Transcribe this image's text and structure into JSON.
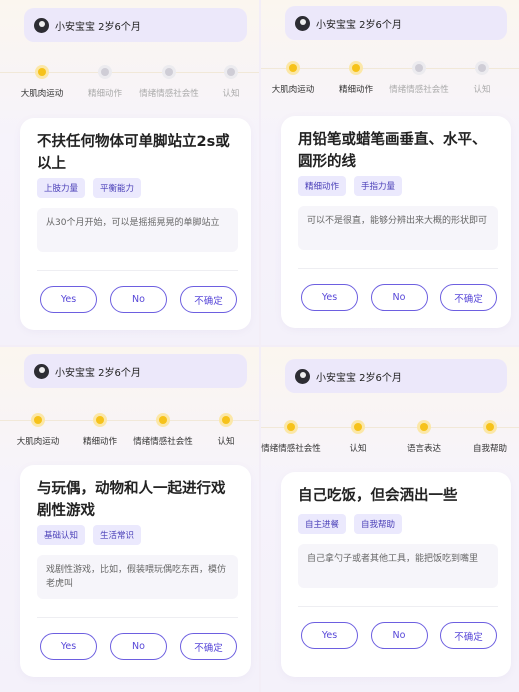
{
  "profile": {
    "name": "小安宝宝 2岁6个月",
    "avatar_icon": "baby-avatar"
  },
  "colors": {
    "accent": "#5747d8",
    "step_active": "#f6c21a",
    "tag_bg": "#ebe9fd"
  },
  "buttons": {
    "yes": "Yes",
    "no": "No",
    "unsure": "不确定"
  },
  "panels": [
    {
      "steps": [
        {
          "label": "大肌肉运动",
          "active": true
        },
        {
          "label": "精细动作",
          "active": false
        },
        {
          "label": "情绪情感社会性",
          "active": false
        },
        {
          "label": "认知",
          "active": false
        }
      ],
      "question": "不扶任何物体可单脚站立2s或以上",
      "tags": [
        "上肢力量",
        "平衡能力"
      ],
      "description": "从30个月开始，可以是摇摇晃晃的单脚站立"
    },
    {
      "steps": [
        {
          "label": "大肌肉运动",
          "active": true
        },
        {
          "label": "精细动作",
          "active": true
        },
        {
          "label": "情绪情感社会性",
          "active": false
        },
        {
          "label": "认知",
          "active": false
        }
      ],
      "question": "用铅笔或蜡笔画垂直、水平、圆形的线",
      "tags": [
        "精细动作",
        "手指力量"
      ],
      "description": "可以不是很直，能够分辨出来大概的形状即可"
    },
    {
      "steps": [
        {
          "label": "大肌肉运动",
          "active": true
        },
        {
          "label": "精细动作",
          "active": true
        },
        {
          "label": "情绪情感社会性",
          "active": true
        },
        {
          "label": "认知",
          "active": true
        }
      ],
      "question": "与玩偶，动物和人一起进行戏剧性游戏",
      "tags": [
        "基础认知",
        "生活常识"
      ],
      "description": "戏剧性游戏，比如，假装喂玩偶吃东西，模仿老虎叫"
    },
    {
      "steps": [
        {
          "label": "情绪情感社会性",
          "active": true
        },
        {
          "label": "认知",
          "active": true
        },
        {
          "label": "语言表达",
          "active": true
        },
        {
          "label": "自我帮助",
          "active": true
        }
      ],
      "question": "自己吃饭，但会洒出一些",
      "tags": [
        "自主进餐",
        "自我帮助"
      ],
      "description": "自己拿勺子或者其他工具，能把饭吃到嘴里"
    }
  ]
}
